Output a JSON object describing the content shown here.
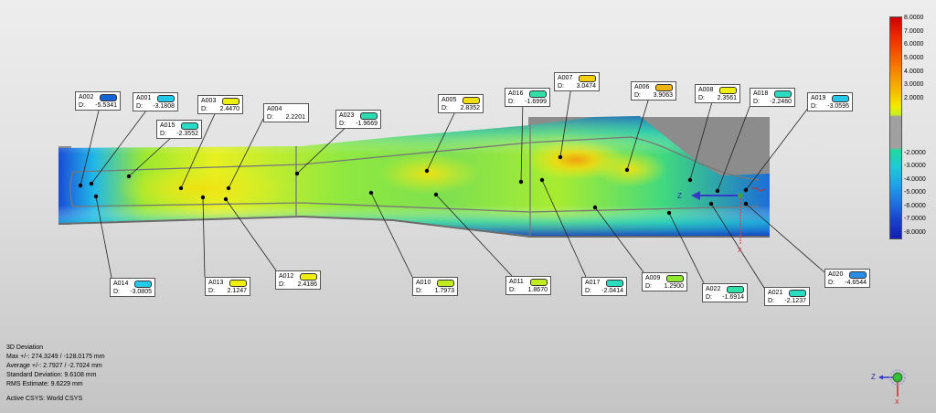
{
  "callouts": [
    {
      "name": "A002",
      "value": "-5.5341",
      "color": "#1464d8"
    },
    {
      "name": "A001",
      "value": "-3.1808",
      "color": "#24c8e8"
    },
    {
      "name": "A015",
      "value": "-2.3552",
      "color": "#2adcc8"
    },
    {
      "name": "A003",
      "value": "2.4470",
      "color": "#f0f010"
    },
    {
      "name": "A004",
      "value": "2.2201",
      "color": "#f0f010"
    },
    {
      "name": "A023",
      "value": "-1.9669",
      "color": "#2adcb0"
    },
    {
      "name": "A005",
      "value": "2.8352",
      "color": "#f0e010"
    },
    {
      "name": "A016",
      "value": "-1.6999",
      "color": "#30e0a8"
    },
    {
      "name": "A007",
      "value": "3.0474",
      "color": "#f0d010"
    },
    {
      "name": "A006",
      "value": "3.9063",
      "color": "#f0b410"
    },
    {
      "name": "A008",
      "value": "2.3561",
      "color": "#f0f010"
    },
    {
      "name": "A018",
      "value": "-2.2460",
      "color": "#2adcc0"
    },
    {
      "name": "A019",
      "value": "-3.0595",
      "color": "#24c8e8"
    },
    {
      "name": "A014",
      "value": "-3.0805",
      "color": "#24c8e8"
    },
    {
      "name": "A013",
      "value": "2.1247",
      "color": "#f0f010"
    },
    {
      "name": "A012",
      "value": "2.4186",
      "color": "#f0f010"
    },
    {
      "name": "A010",
      "value": "1.7973",
      "color": "#c0ec20"
    },
    {
      "name": "A011",
      "value": "1.8670",
      "color": "#c0ec20"
    },
    {
      "name": "A017",
      "value": "-2.0414",
      "color": "#2adcc0"
    },
    {
      "name": "A009",
      "value": "1.2900",
      "color": "#90e830"
    },
    {
      "name": "A022",
      "value": "-1.6914",
      "color": "#30e0a8"
    },
    {
      "name": "A021",
      "value": "-2.1237",
      "color": "#2adcc0"
    },
    {
      "name": "A020",
      "value": "-4.6544",
      "color": "#2a8ee8"
    }
  ],
  "callout_prefix": "D:",
  "legend": {
    "labels": [
      "8.0000",
      "7.0000",
      "6.0000",
      "5.0000",
      "4.0000",
      "3.0000",
      "2.0000",
      "-2.0000",
      "-3.0000",
      "-4.0000",
      "-5.0000",
      "-6.0000",
      "-7.0000",
      "-8.0000"
    ],
    "colors": [
      "#d40000",
      "#ec2000",
      "#f45000",
      "#f48000",
      "#f4b000",
      "#f4e000",
      "#c8f020",
      "#20d8a0",
      "#20c8d8",
      "#20a8e8",
      "#2070e0",
      "#1848d0",
      "#1020b0"
    ]
  },
  "stats": {
    "title": "3D Deviation",
    "max": "Max +/-: 274.3249 / -128.0175 mm",
    "avg": "Average +/-: 2.7927 / -2.7024 mm",
    "std": "Standard Deviation: 9.6108 mm",
    "rms": "RMS Estimate: 9.6229 mm",
    "csys": "Active CSYS: World CSYS"
  },
  "axes": {
    "z": "Z",
    "x": "X"
  }
}
